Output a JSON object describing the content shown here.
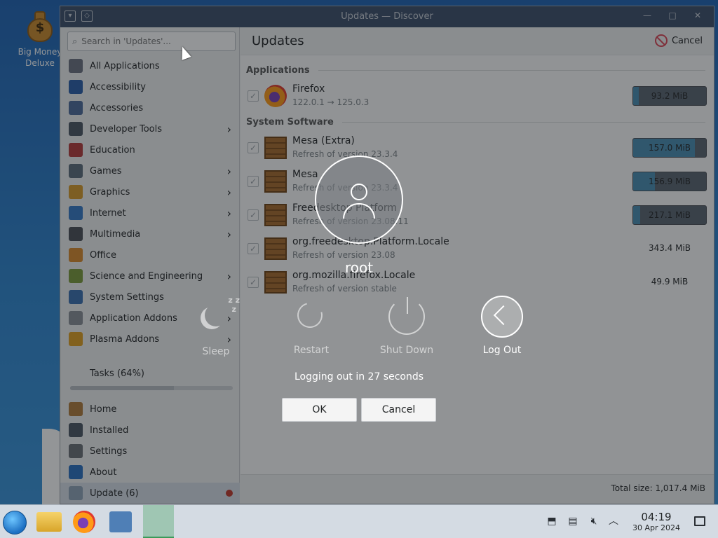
{
  "desktop": {
    "icon_label": "Big Money Deluxe",
    "icon_sign": "$"
  },
  "window": {
    "title": "Updates — Discover",
    "search_placeholder": "Search in 'Updates'...",
    "categories": [
      {
        "label": "All Applications",
        "icon": "grid-icon",
        "color": "#6b7280",
        "arrow": false
      },
      {
        "label": "Accessibility",
        "icon": "accessibility-icon",
        "color": "#2a5da8",
        "arrow": false
      },
      {
        "label": "Accessories",
        "icon": "accessories-icon",
        "color": "#4d6a9a",
        "arrow": false
      },
      {
        "label": "Developer Tools",
        "icon": "developer-tools-icon",
        "color": "#4a5562",
        "arrow": true
      },
      {
        "label": "Education",
        "icon": "education-icon",
        "color": "#b33a3a",
        "arrow": false
      },
      {
        "label": "Games",
        "icon": "games-icon",
        "color": "#5c6b7a",
        "arrow": true
      },
      {
        "label": "Graphics",
        "icon": "graphics-icon",
        "color": "#d69a2a",
        "arrow": true
      },
      {
        "label": "Internet",
        "icon": "internet-icon",
        "color": "#3478c6",
        "arrow": true
      },
      {
        "label": "Multimedia",
        "icon": "multimedia-icon",
        "color": "#4a4f55",
        "arrow": true
      },
      {
        "label": "Office",
        "icon": "office-icon",
        "color": "#d98a2b",
        "arrow": false
      },
      {
        "label": "Science and Engineering",
        "icon": "science-icon",
        "color": "#7a9a3a",
        "arrow": true
      },
      {
        "label": "System Settings",
        "icon": "system-settings-icon",
        "color": "#3a6fb0",
        "arrow": false
      },
      {
        "label": "Application Addons",
        "icon": "application-addons-icon",
        "color": "#8a8f96",
        "arrow": true
      },
      {
        "label": "Plasma Addons",
        "icon": "plasma-addons-icon",
        "color": "#e0a020",
        "arrow": true
      }
    ],
    "tasks_label": "Tasks (64%)",
    "tasks_progress": 0.64,
    "nav": [
      {
        "label": "Home",
        "icon": "home-icon",
        "color": "#b07a3a"
      },
      {
        "label": "Installed",
        "icon": "installed-icon",
        "color": "#4a5562"
      },
      {
        "label": "Settings",
        "icon": "settings-icon",
        "color": "#6a6f75"
      },
      {
        "label": "About",
        "icon": "about-icon",
        "color": "#2a6fc0"
      },
      {
        "label": "Update (6)",
        "icon": "update-icon",
        "color": "#8fa3b8",
        "badge": true
      }
    ]
  },
  "main": {
    "title": "Updates",
    "cancel_label": "Cancel",
    "sections": {
      "applications": "Applications",
      "system": "System Software"
    },
    "apps": [
      {
        "name": "Firefox",
        "sub": "122.0.1 → 125.0.3",
        "size": "93.2 MiB",
        "progress": 0.08,
        "icon": "firefox-icon"
      }
    ],
    "system": [
      {
        "name": "Mesa (Extra)",
        "sub": "Refresh of version 23.3.4",
        "size": "157.0 MiB",
        "progress": 0.85,
        "plain": false
      },
      {
        "name": "Mesa",
        "sub": "Refresh of version 23.3.4",
        "size": "156.9 MiB",
        "progress": 0.3,
        "plain": false
      },
      {
        "name": "Freedesktop Platform",
        "sub": "Refresh of version 23.08.11",
        "size": "217.1 MiB",
        "progress": 0.1,
        "plain": false
      },
      {
        "name": "org.freedesktop.Platform.Locale",
        "sub": "Refresh of version 23.08",
        "size": "343.4 MiB",
        "progress": 0,
        "plain": true
      },
      {
        "name": "org.mozilla.firefox.Locale",
        "sub": "Refresh of version stable",
        "size": "49.9 MiB",
        "progress": 0,
        "plain": true
      }
    ],
    "total": "Total size: 1,017.4 MiB"
  },
  "logout": {
    "username": "root",
    "actions": {
      "sleep": "Sleep",
      "restart": "Restart",
      "shutdown": "Shut Down",
      "logout": "Log Out"
    },
    "countdown": "Logging out in 27 seconds",
    "ok": "OK",
    "cancel": "Cancel"
  },
  "taskbar": {
    "time": "04:19",
    "date": "30 Apr 2024"
  }
}
